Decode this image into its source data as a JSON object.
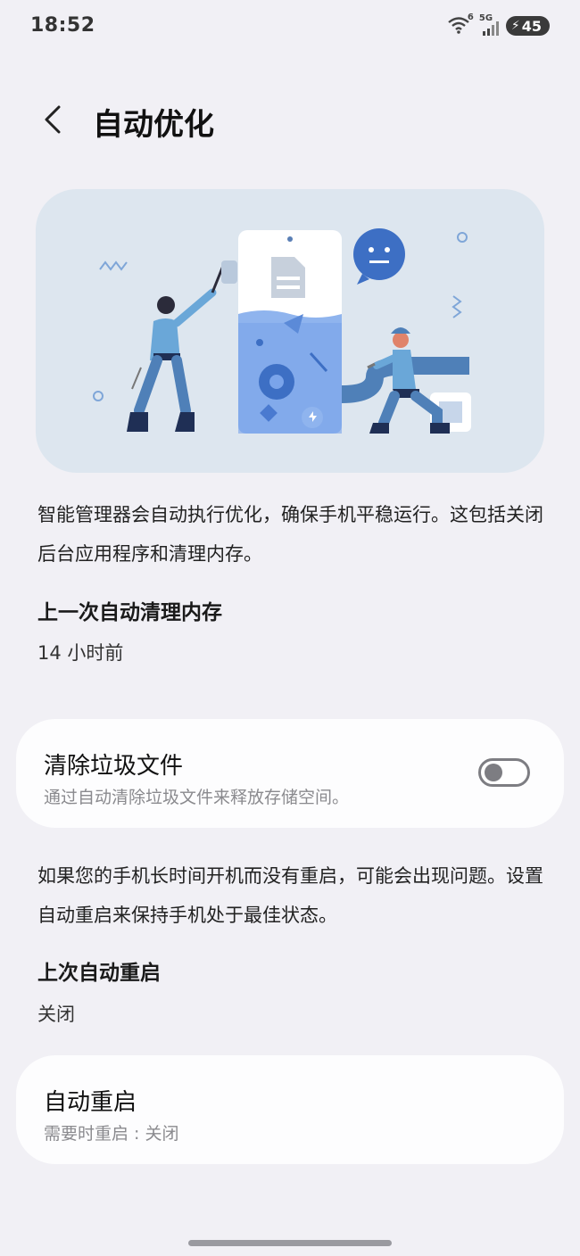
{
  "status_bar": {
    "time": "18:52",
    "network_label": "5G",
    "wifi_badge": "6",
    "battery_level": "45"
  },
  "header": {
    "title": "自动优化"
  },
  "intro": {
    "text": "智能管理器会自动执行优化，确保手机平稳运行。这包括关闭后台应用程序和清理内存。"
  },
  "memory_section": {
    "title": "上一次自动清理内存",
    "value": "14 小时前"
  },
  "junk_card": {
    "title": "清除垃圾文件",
    "subtitle": "通过自动清除垃圾文件来释放存储空间。",
    "toggle_on": false
  },
  "restart_intro": {
    "text": "如果您的手机长时间开机而没有重启，可能会出现问题。设置自动重启来保持手机处于最佳状态。"
  },
  "restart_section": {
    "title": "上次自动重启",
    "value": "关闭"
  },
  "restart_card": {
    "title": "自动重启",
    "subtitle": "需要时重启 : 关闭"
  },
  "colors": {
    "background": "#f1f0f5",
    "card": "#fdfdfe",
    "illustration_bg": "#dde6ef",
    "accent_blue": "#3d6fc4"
  }
}
